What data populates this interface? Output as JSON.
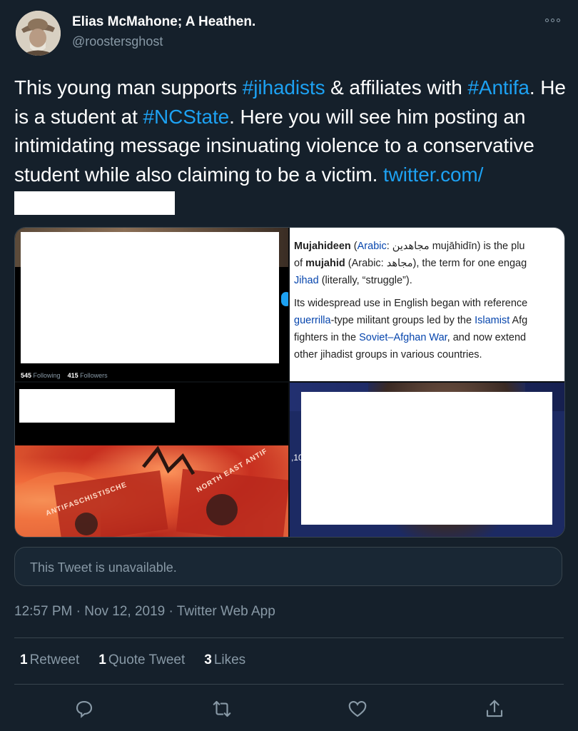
{
  "author": {
    "name": "Elias McMahone; A Heathen.",
    "handle": "@roostersghost"
  },
  "tweet": {
    "text_parts": {
      "p1": "This young man supports ",
      "tag1": "#jihadists",
      "p2": " & affiliates with ",
      "tag2": "#Antifa",
      "p3": ". He is a student at ",
      "tag3": "#NCState",
      "p4": ".  Here you will see him posting an intimidating message insinuating violence to a conservative student while also claiming to be a victim.  ",
      "link": "twitter.com/"
    }
  },
  "media": {
    "profile_stats": {
      "following_count": "545",
      "following_label": "Following",
      "followers_count": "415",
      "followers_label": "Followers"
    },
    "wiki": {
      "term": "Mujahideen",
      "p1_a": " (",
      "arabic_link": "Arabic",
      "p1_b": ": مجاهدين mujāhidīn) is the plu",
      "p2_a": "of ",
      "term2": "mujahid",
      "p2_b": " (Arabic: مجاهد), the term for one engag",
      "jihad_link": "Jihad",
      "p3_b": " (literally, “struggle”).",
      "p4": "Its widespread use in English began with reference",
      "guerrilla_link": "guerrilla",
      "p5_b": "-type militant groups led by the ",
      "islamist_link": "Islamist",
      "p5_c": " Afg",
      "p6_a": "fighters in the ",
      "war_link": "Soviet–Afghan War",
      "p6_b": ", and now extend",
      "p7": "other jihadist groups in various countries."
    },
    "banner_texts": [
      "NORTH EAST ANTIF",
      "ANTIFASCHISTISCHE"
    ],
    "side_number": ",10"
  },
  "quoted": {
    "unavailable_text": "This Tweet is unavailable."
  },
  "meta": {
    "time": "12:57 PM",
    "sep1": " · ",
    "date": "Nov 12, 2019",
    "sep2": " · ",
    "source": "Twitter Web App"
  },
  "counts": {
    "retweets": "1",
    "retweets_label": "Retweet",
    "quotes": "1",
    "quotes_label": "Quote Tweet",
    "likes": "3",
    "likes_label": "Likes"
  },
  "icons": {
    "reply": "reply-icon",
    "retweet": "retweet-icon",
    "like": "heart-icon",
    "share": "share-icon",
    "more": "more-icon"
  },
  "colors": {
    "background": "#15202b",
    "accent": "#1da1f2",
    "muted": "#8899a6",
    "border": "#38444d"
  }
}
